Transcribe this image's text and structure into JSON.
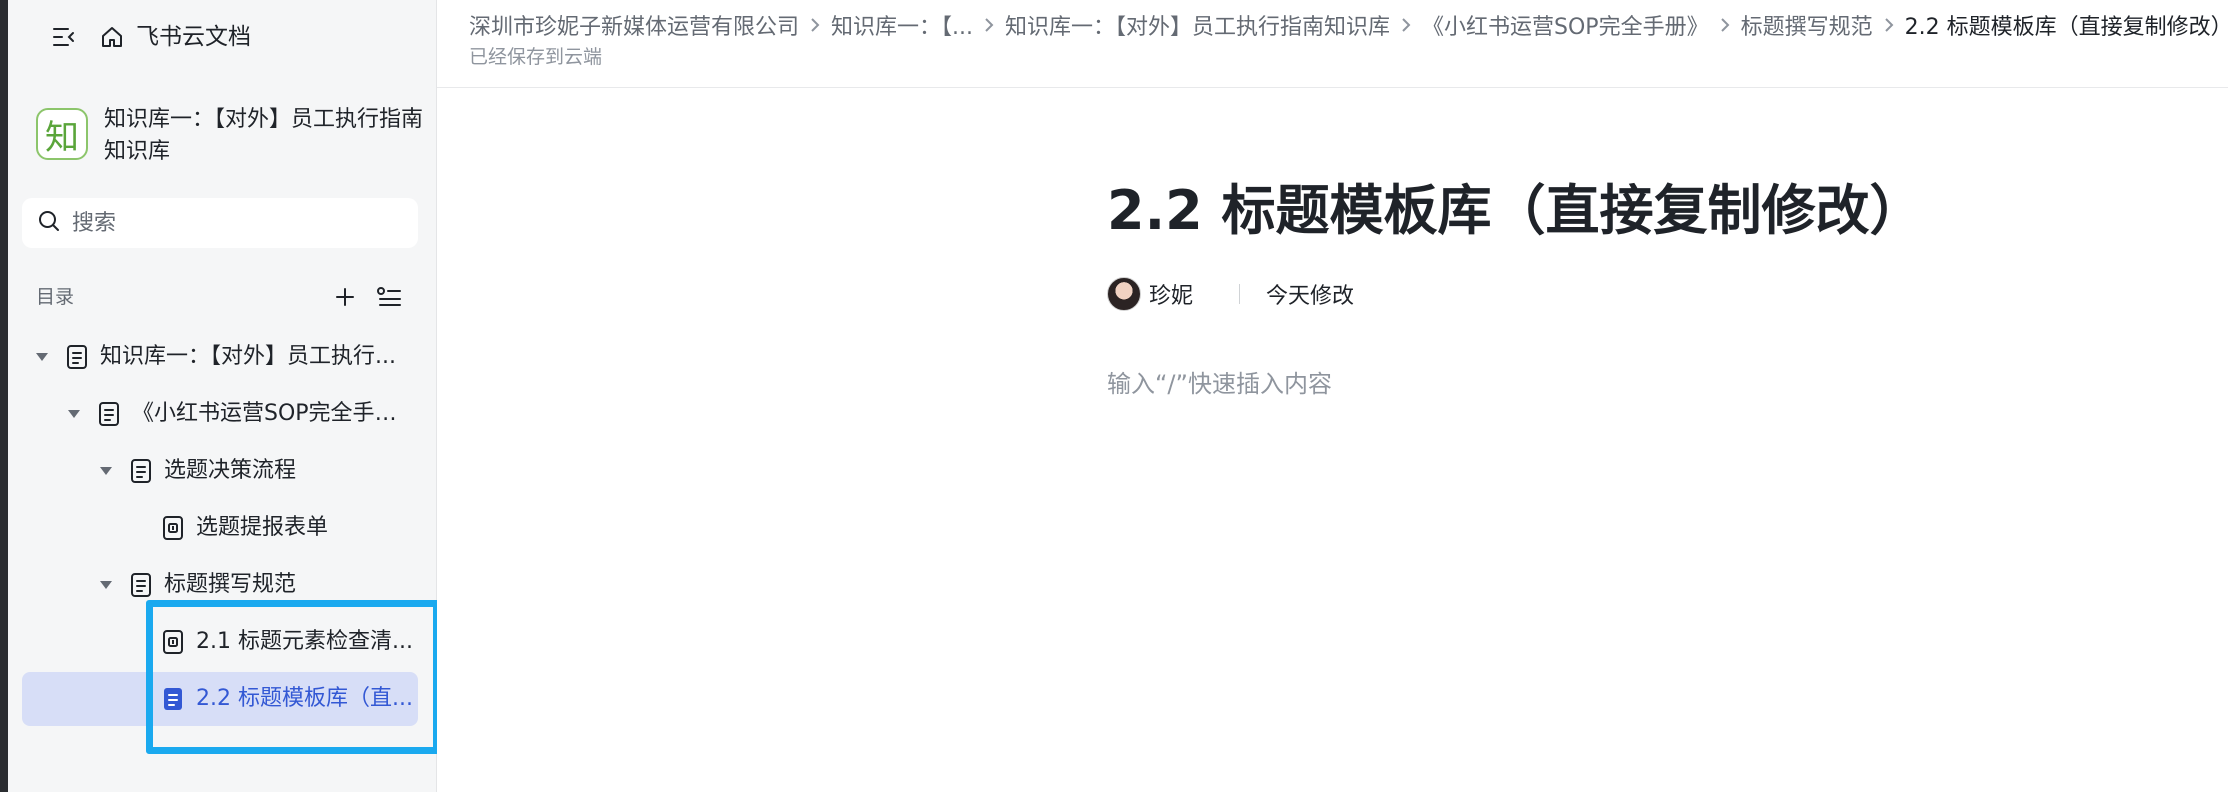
{
  "app": {
    "name": "飞书云文档"
  },
  "knowledge_base": {
    "logo_char": "知",
    "title": "知识库一：【对外】员工执行指南知识库"
  },
  "search": {
    "placeholder": "搜索"
  },
  "toc": {
    "label": "目录",
    "items": [
      {
        "label": "知识库一：【对外】员工执行...",
        "type": "doc",
        "expanded": true,
        "level": 0
      },
      {
        "label": "《小红书运营SOP完全手册...",
        "type": "doc",
        "expanded": true,
        "level": 1
      },
      {
        "label": "选题决策流程",
        "type": "doc",
        "expanded": true,
        "level": 2
      },
      {
        "label": "选题提报表单",
        "type": "form",
        "level": 3
      },
      {
        "label": "标题撰写规范",
        "type": "doc",
        "expanded": true,
        "level": 2
      },
      {
        "label": "2.1 标题元素检查清...",
        "type": "form",
        "level": 3
      },
      {
        "label": "2.2 标题模板库（直...",
        "type": "doc",
        "level": 3,
        "active": true
      }
    ]
  },
  "breadcrumb": {
    "items": [
      "深圳市珍妮子新媒体运营有限公司",
      "知识库一：【...",
      "知识库一：【对外】员工执行指南知识库",
      "《小红书运营SOP完全手册》",
      "标题撰写规范"
    ],
    "current": "2.2 标题模板库（直接复制修改）"
  },
  "save_status": "已经保存到云端",
  "document": {
    "title": "2.2 标题模板库（直接复制修改）",
    "author": "珍妮",
    "modified": "今天修改",
    "body_placeholder": "输入“/”快速插入内容"
  },
  "colors": {
    "accent": "#3358d4",
    "active_bg": "#d7def7",
    "highlight": "#1aa9ef",
    "kb_logo": "#5aa53a"
  }
}
